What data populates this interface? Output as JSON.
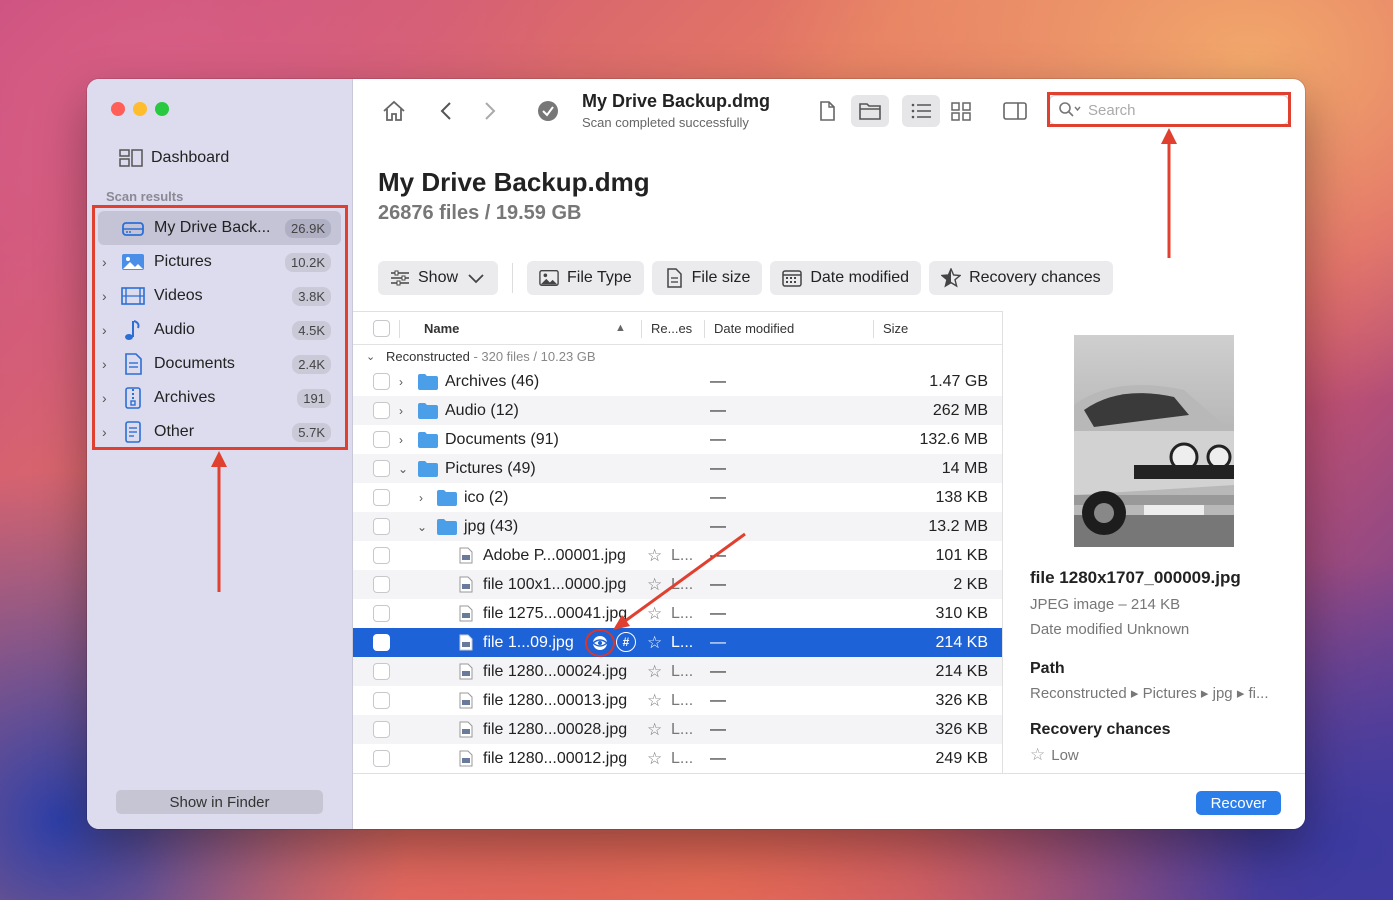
{
  "sidebar": {
    "dashboard_label": "Dashboard",
    "section_title": "Scan results",
    "items": [
      {
        "label": "My Drive Back...",
        "count": "26.9K",
        "icon": "drive-icon"
      },
      {
        "label": "Pictures",
        "count": "10.2K",
        "icon": "pictures-icon"
      },
      {
        "label": "Videos",
        "count": "3.8K",
        "icon": "videos-icon"
      },
      {
        "label": "Audio",
        "count": "4.5K",
        "icon": "audio-icon"
      },
      {
        "label": "Documents",
        "count": "2.4K",
        "icon": "documents-icon"
      },
      {
        "label": "Archives",
        "count": "191",
        "icon": "archives-icon"
      },
      {
        "label": "Other",
        "count": "5.7K",
        "icon": "other-icon"
      }
    ],
    "show_in_finder": "Show in Finder"
  },
  "toolbar": {
    "title": "My Drive Backup.dmg",
    "subtitle": "Scan completed successfully",
    "search_placeholder": "Search"
  },
  "header": {
    "title": "My Drive Backup.dmg",
    "subtitle": "26876 files / 19.59 GB"
  },
  "filters": {
    "show": "Show",
    "file_type": "File Type",
    "file_size": "File size",
    "date_modified": "Date modified",
    "recovery_chances": "Recovery chances"
  },
  "table": {
    "columns": {
      "name": "Name",
      "recovery": "Re...es",
      "date": "Date modified",
      "size": "Size"
    },
    "group": {
      "name": "Reconstructed",
      "info": " - 320 files / 10.23 GB"
    },
    "rows": [
      {
        "name": "Archives (46)",
        "date": "—",
        "size": "1.47 GB"
      },
      {
        "name": "Audio (12)",
        "date": "—",
        "size": "262 MB"
      },
      {
        "name": "Documents (91)",
        "date": "—",
        "size": "132.6 MB"
      },
      {
        "name": "Pictures (49)",
        "date": "—",
        "size": "14 MB"
      },
      {
        "name": "ico (2)",
        "date": "—",
        "size": "138 KB"
      },
      {
        "name": "jpg (43)",
        "date": "—",
        "size": "13.2 MB"
      },
      {
        "name": "Adobe P...00001.jpg",
        "recovery": "L...",
        "date": "—",
        "size": "101 KB"
      },
      {
        "name": "file 100x1...0000.jpg",
        "recovery": "L...",
        "date": "—",
        "size": "2 KB"
      },
      {
        "name": "file 1275...00041.jpg",
        "recovery": "L...",
        "date": "—",
        "size": "310 KB"
      },
      {
        "name": "file 1...09.jpg",
        "recovery": "L...",
        "date": "—",
        "size": "214 KB"
      },
      {
        "name": "file 1280...00024.jpg",
        "recovery": "L...",
        "date": "—",
        "size": "214 KB"
      },
      {
        "name": "file 1280...00013.jpg",
        "recovery": "L...",
        "date": "—",
        "size": "326 KB"
      },
      {
        "name": "file 1280...00028.jpg",
        "recovery": "L...",
        "date": "—",
        "size": "326 KB"
      },
      {
        "name": "file 1280...00012.jpg",
        "recovery": "L...",
        "date": "—",
        "size": "249 KB"
      }
    ]
  },
  "preview": {
    "file_name": "file 1280x1707_000009.jpg",
    "file_type": "JPEG image – 214 KB",
    "date_modified": "Date modified  Unknown",
    "path_label": "Path",
    "path_value": "Reconstructed ▸ Pictures ▸ jpg ▸ fi...",
    "recovery_label": "Recovery chances",
    "recovery_value": "Low"
  },
  "footer": {
    "recover": "Recover"
  },
  "colors": {
    "accent": "#1d62d6",
    "annotation": "#e0402f"
  }
}
